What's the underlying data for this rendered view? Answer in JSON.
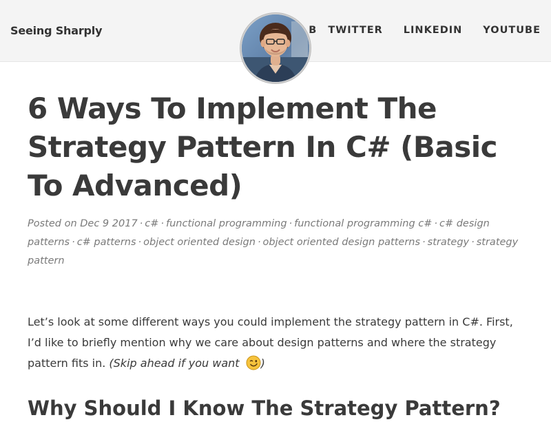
{
  "header": {
    "brand": "Seeing Sharply",
    "nav": [
      "B",
      "TWITTER",
      "LINKEDIN",
      "YOUTUBE"
    ]
  },
  "article": {
    "title": "6 Ways To Implement The Strategy Pattern In C# (Basic To Advanced)",
    "posted_prefix": "Posted on Dec 9 2017",
    "tags": [
      "c#",
      "functional programming",
      "functional programming c#",
      "c# design patterns",
      "c# patterns",
      "object oriented design",
      "object oriented design patterns",
      "strategy",
      "strategy pattern"
    ],
    "lead_text": "Let’s look at some different ways you could implement the strategy pattern in C#. First, I’d like to briefly mention why we care about design patterns and where the strategy pattern fits in. ",
    "skip_link": "(Skip ahead if you want",
    "skip_close": ")",
    "section_heading": "Why Should I Know The Strategy Pattern?"
  }
}
